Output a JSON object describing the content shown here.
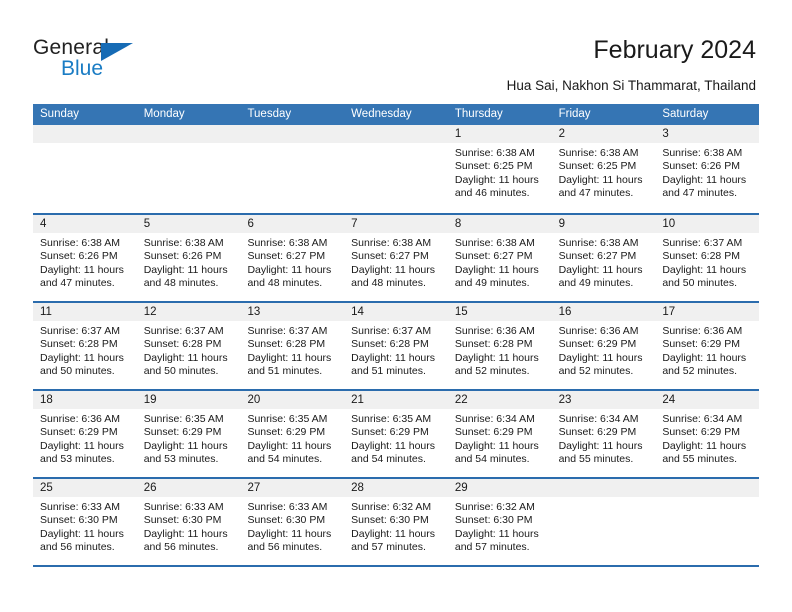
{
  "brand": {
    "name_part1": "General",
    "name_part2": "Blue",
    "triangle_color": "#166bb5",
    "blue_color": "#1a7cc4"
  },
  "header": {
    "title": "February 2024",
    "subtitle": "Hua Sai, Nakhon Si Thammarat, Thailand"
  },
  "theme": {
    "header_bg": "#3575b4",
    "week_divider": "#2b6cad",
    "day_number_bg": "#f0f0f0"
  },
  "weekdays": [
    "Sunday",
    "Monday",
    "Tuesday",
    "Wednesday",
    "Thursday",
    "Friday",
    "Saturday"
  ],
  "weeks": [
    [
      {
        "day": "",
        "sunrise": "",
        "sunset": "",
        "daylight": "",
        "daylight2": ""
      },
      {
        "day": "",
        "sunrise": "",
        "sunset": "",
        "daylight": "",
        "daylight2": ""
      },
      {
        "day": "",
        "sunrise": "",
        "sunset": "",
        "daylight": "",
        "daylight2": ""
      },
      {
        "day": "",
        "sunrise": "",
        "sunset": "",
        "daylight": "",
        "daylight2": ""
      },
      {
        "day": "1",
        "sunrise": "Sunrise: 6:38 AM",
        "sunset": "Sunset: 6:25 PM",
        "daylight": "Daylight: 11 hours",
        "daylight2": "and 46 minutes."
      },
      {
        "day": "2",
        "sunrise": "Sunrise: 6:38 AM",
        "sunset": "Sunset: 6:25 PM",
        "daylight": "Daylight: 11 hours",
        "daylight2": "and 47 minutes."
      },
      {
        "day": "3",
        "sunrise": "Sunrise: 6:38 AM",
        "sunset": "Sunset: 6:26 PM",
        "daylight": "Daylight: 11 hours",
        "daylight2": "and 47 minutes."
      }
    ],
    [
      {
        "day": "4",
        "sunrise": "Sunrise: 6:38 AM",
        "sunset": "Sunset: 6:26 PM",
        "daylight": "Daylight: 11 hours",
        "daylight2": "and 47 minutes."
      },
      {
        "day": "5",
        "sunrise": "Sunrise: 6:38 AM",
        "sunset": "Sunset: 6:26 PM",
        "daylight": "Daylight: 11 hours",
        "daylight2": "and 48 minutes."
      },
      {
        "day": "6",
        "sunrise": "Sunrise: 6:38 AM",
        "sunset": "Sunset: 6:27 PM",
        "daylight": "Daylight: 11 hours",
        "daylight2": "and 48 minutes."
      },
      {
        "day": "7",
        "sunrise": "Sunrise: 6:38 AM",
        "sunset": "Sunset: 6:27 PM",
        "daylight": "Daylight: 11 hours",
        "daylight2": "and 48 minutes."
      },
      {
        "day": "8",
        "sunrise": "Sunrise: 6:38 AM",
        "sunset": "Sunset: 6:27 PM",
        "daylight": "Daylight: 11 hours",
        "daylight2": "and 49 minutes."
      },
      {
        "day": "9",
        "sunrise": "Sunrise: 6:38 AM",
        "sunset": "Sunset: 6:27 PM",
        "daylight": "Daylight: 11 hours",
        "daylight2": "and 49 minutes."
      },
      {
        "day": "10",
        "sunrise": "Sunrise: 6:37 AM",
        "sunset": "Sunset: 6:28 PM",
        "daylight": "Daylight: 11 hours",
        "daylight2": "and 50 minutes."
      }
    ],
    [
      {
        "day": "11",
        "sunrise": "Sunrise: 6:37 AM",
        "sunset": "Sunset: 6:28 PM",
        "daylight": "Daylight: 11 hours",
        "daylight2": "and 50 minutes."
      },
      {
        "day": "12",
        "sunrise": "Sunrise: 6:37 AM",
        "sunset": "Sunset: 6:28 PM",
        "daylight": "Daylight: 11 hours",
        "daylight2": "and 50 minutes."
      },
      {
        "day": "13",
        "sunrise": "Sunrise: 6:37 AM",
        "sunset": "Sunset: 6:28 PM",
        "daylight": "Daylight: 11 hours",
        "daylight2": "and 51 minutes."
      },
      {
        "day": "14",
        "sunrise": "Sunrise: 6:37 AM",
        "sunset": "Sunset: 6:28 PM",
        "daylight": "Daylight: 11 hours",
        "daylight2": "and 51 minutes."
      },
      {
        "day": "15",
        "sunrise": "Sunrise: 6:36 AM",
        "sunset": "Sunset: 6:28 PM",
        "daylight": "Daylight: 11 hours",
        "daylight2": "and 52 minutes."
      },
      {
        "day": "16",
        "sunrise": "Sunrise: 6:36 AM",
        "sunset": "Sunset: 6:29 PM",
        "daylight": "Daylight: 11 hours",
        "daylight2": "and 52 minutes."
      },
      {
        "day": "17",
        "sunrise": "Sunrise: 6:36 AM",
        "sunset": "Sunset: 6:29 PM",
        "daylight": "Daylight: 11 hours",
        "daylight2": "and 52 minutes."
      }
    ],
    [
      {
        "day": "18",
        "sunrise": "Sunrise: 6:36 AM",
        "sunset": "Sunset: 6:29 PM",
        "daylight": "Daylight: 11 hours",
        "daylight2": "and 53 minutes."
      },
      {
        "day": "19",
        "sunrise": "Sunrise: 6:35 AM",
        "sunset": "Sunset: 6:29 PM",
        "daylight": "Daylight: 11 hours",
        "daylight2": "and 53 minutes."
      },
      {
        "day": "20",
        "sunrise": "Sunrise: 6:35 AM",
        "sunset": "Sunset: 6:29 PM",
        "daylight": "Daylight: 11 hours",
        "daylight2": "and 54 minutes."
      },
      {
        "day": "21",
        "sunrise": "Sunrise: 6:35 AM",
        "sunset": "Sunset: 6:29 PM",
        "daylight": "Daylight: 11 hours",
        "daylight2": "and 54 minutes."
      },
      {
        "day": "22",
        "sunrise": "Sunrise: 6:34 AM",
        "sunset": "Sunset: 6:29 PM",
        "daylight": "Daylight: 11 hours",
        "daylight2": "and 54 minutes."
      },
      {
        "day": "23",
        "sunrise": "Sunrise: 6:34 AM",
        "sunset": "Sunset: 6:29 PM",
        "daylight": "Daylight: 11 hours",
        "daylight2": "and 55 minutes."
      },
      {
        "day": "24",
        "sunrise": "Sunrise: 6:34 AM",
        "sunset": "Sunset: 6:29 PM",
        "daylight": "Daylight: 11 hours",
        "daylight2": "and 55 minutes."
      }
    ],
    [
      {
        "day": "25",
        "sunrise": "Sunrise: 6:33 AM",
        "sunset": "Sunset: 6:30 PM",
        "daylight": "Daylight: 11 hours",
        "daylight2": "and 56 minutes."
      },
      {
        "day": "26",
        "sunrise": "Sunrise: 6:33 AM",
        "sunset": "Sunset: 6:30 PM",
        "daylight": "Daylight: 11 hours",
        "daylight2": "and 56 minutes."
      },
      {
        "day": "27",
        "sunrise": "Sunrise: 6:33 AM",
        "sunset": "Sunset: 6:30 PM",
        "daylight": "Daylight: 11 hours",
        "daylight2": "and 56 minutes."
      },
      {
        "day": "28",
        "sunrise": "Sunrise: 6:32 AM",
        "sunset": "Sunset: 6:30 PM",
        "daylight": "Daylight: 11 hours",
        "daylight2": "and 57 minutes."
      },
      {
        "day": "29",
        "sunrise": "Sunrise: 6:32 AM",
        "sunset": "Sunset: 6:30 PM",
        "daylight": "Daylight: 11 hours",
        "daylight2": "and 57 minutes."
      },
      {
        "day": "",
        "sunrise": "",
        "sunset": "",
        "daylight": "",
        "daylight2": ""
      },
      {
        "day": "",
        "sunrise": "",
        "sunset": "",
        "daylight": "",
        "daylight2": ""
      }
    ]
  ]
}
